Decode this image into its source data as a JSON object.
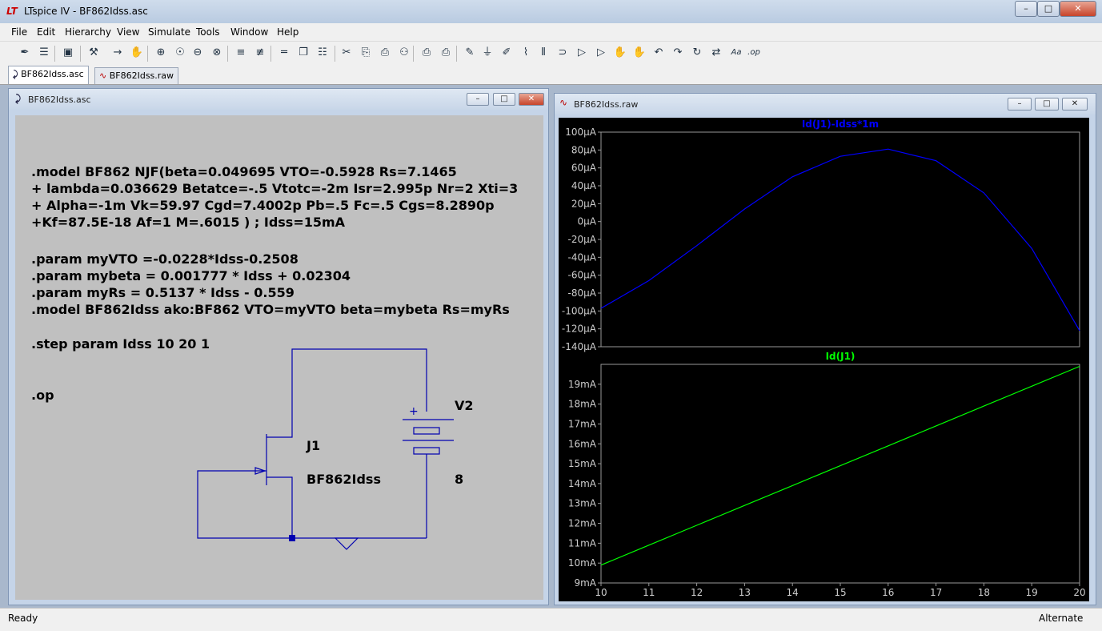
{
  "app": {
    "title": "LTspice IV - BF862Idss.asc",
    "logo": "LT"
  },
  "window_controls": {
    "minimize": "–",
    "maximize": "□",
    "close": "✕"
  },
  "menu": [
    "File",
    "Edit",
    "Hierarchy",
    "View",
    "Simulate",
    "Tools",
    "Window",
    "Help"
  ],
  "toolbar_icons": [
    "new-schematic-icon",
    "open-icon",
    "save-icon",
    "control-panel-icon",
    "run-icon",
    "halt-icon",
    "zoom-in-icon",
    "zoom-pan-icon",
    "zoom-out-icon",
    "zoom-cancel-icon",
    "autorange-icon",
    "delete-trace-icon",
    "tile-vertical-icon",
    "cascade-icon",
    "tile-horizontal-icon",
    "cut-icon",
    "copy-icon",
    "paste-icon",
    "find-icon",
    "print-setup-icon",
    "print-icon",
    "draw-wire-icon",
    "ground-icon",
    "label-net-icon",
    "resistor-icon",
    "capacitor-icon",
    "inductor-icon",
    "diode-icon",
    "component-icon",
    "move-icon",
    "drag-icon",
    "undo-icon",
    "redo-icon",
    "rotate-icon",
    "mirror-icon",
    "text-icon",
    "spice-directive-icon"
  ],
  "toolbar_glyphs": [
    "✒",
    "☰",
    "▣",
    "⚒",
    "→",
    "✋",
    "⊕",
    "☉",
    "⊖",
    "⊗",
    "≡",
    "≢",
    "═",
    "❐",
    "☷",
    "✂",
    "⎘",
    "⎙",
    "⚇",
    "⎙",
    "⎙",
    "✎",
    "⏚",
    "✐",
    "⌇",
    "⦀",
    "⊃",
    "▷",
    "▷",
    "✋",
    "✋",
    "↶",
    "↷",
    "↻",
    "⇄",
    "Aa",
    ".op"
  ],
  "tabs": [
    {
      "label": "BF862Idss.asc",
      "icon": "schematic-icon"
    },
    {
      "label": "BF862Idss.raw",
      "icon": "waveform-icon"
    }
  ],
  "schematic_window": {
    "title": "BF862Idss.asc",
    "directives": [
      ".model BF862 NJF(beta=0.049695 VTO=-0.5928 Rs=7.1465",
      "+ lambda=0.036629 Betatce=-.5 Vtotc=-2m Isr=2.995p Nr=2 Xti=3",
      "+ Alpha=-1m Vk=59.97 Cgd=7.4002p Pb=.5 Fc=.5 Cgs=8.2890p",
      "+Kf=87.5E-18 Af=1 M=.6015 ) ; Idss=15mA",
      ".param myVTO =-0.0228*Idss-0.2508",
      ".param mybeta = 0.001777 * Idss + 0.02304",
      ".param myRs = 0.5137 * Idss - 0.559",
      ".model BF862Idss ako:BF862 VTO=myVTO beta=mybeta Rs=myRs",
      ".step param Idss 10 20 1",
      ".op"
    ],
    "components": {
      "j1_name": "J1",
      "j1_model": "BF862Idss",
      "v2_name": "V2",
      "v2_value": "8",
      "v2_plus": "+"
    }
  },
  "waveform_window": {
    "title": "BF862Idss.raw"
  },
  "chart_data": [
    {
      "type": "line",
      "title": "Id(J1)-Idss*1m",
      "color": "#0000ff",
      "x": [
        10,
        11,
        12,
        13,
        14,
        15,
        16,
        17,
        18,
        19,
        20
      ],
      "series": [
        {
          "name": "Id(J1)-Idss*1m",
          "values": [
            -97,
            -66,
            -27,
            14,
            50,
            73,
            81,
            68,
            32,
            -30,
            -122
          ]
        }
      ],
      "ylim": [
        -140,
        100
      ],
      "yticks": [
        100,
        80,
        60,
        40,
        20,
        0,
        -20,
        -40,
        -60,
        -80,
        -100,
        -120,
        -140
      ],
      "ytick_labels": [
        "100µA",
        "80µA",
        "60µA",
        "40µA",
        "20µA",
        "0µA",
        "-20µA",
        "-40µA",
        "-60µA",
        "-80µA",
        "-100µA",
        "-120µA",
        "-140µA"
      ],
      "xlim": [
        10,
        20
      ]
    },
    {
      "type": "line",
      "title": "Id(J1)",
      "color": "#00ff00",
      "x": [
        10,
        11,
        12,
        13,
        14,
        15,
        16,
        17,
        18,
        19,
        20
      ],
      "series": [
        {
          "name": "Id(J1)",
          "values": [
            9.9,
            10.9,
            11.9,
            12.9,
            13.9,
            14.9,
            15.9,
            16.9,
            17.9,
            18.9,
            19.9
          ]
        }
      ],
      "ylim": [
        9,
        20
      ],
      "yticks": [
        19,
        18,
        17,
        16,
        15,
        14,
        13,
        12,
        11,
        10,
        9
      ],
      "ytick_labels": [
        "19mA",
        "18mA",
        "17mA",
        "16mA",
        "15mA",
        "14mA",
        "13mA",
        "12mA",
        "11mA",
        "10mA",
        "9mA"
      ],
      "xlim": [
        10,
        20
      ],
      "xticks": [
        10,
        11,
        12,
        13,
        14,
        15,
        16,
        17,
        18,
        19,
        20
      ],
      "xtick_labels": [
        "10",
        "11",
        "12",
        "13",
        "14",
        "15",
        "16",
        "17",
        "18",
        "19",
        "20"
      ]
    }
  ],
  "status": {
    "left": "Ready",
    "right": "Alternate"
  }
}
